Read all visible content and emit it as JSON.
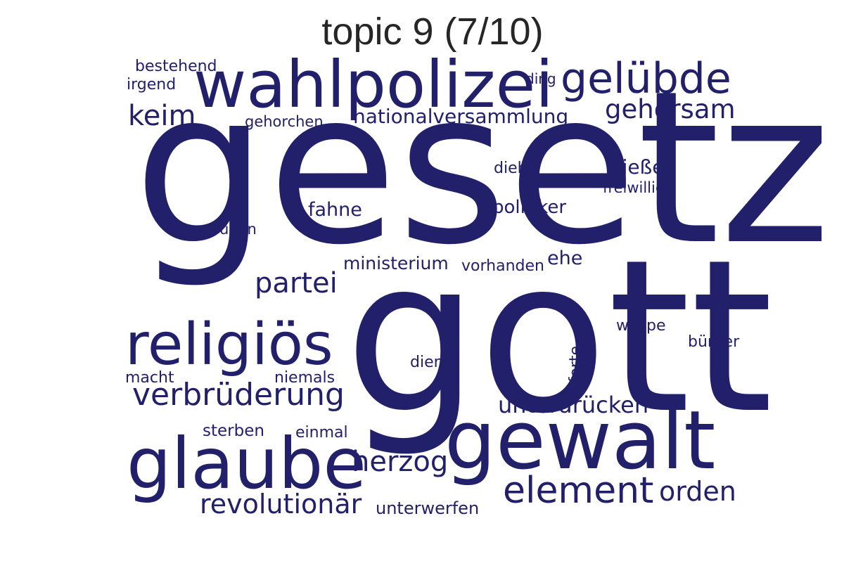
{
  "title": "topic 9 (7/10)",
  "word_color": "#22206b",
  "words": [
    {
      "text": "gesetz"
    },
    {
      "text": "gott"
    },
    {
      "text": "wahlpolizei"
    },
    {
      "text": "religiös"
    },
    {
      "text": "gewalt"
    },
    {
      "text": "glaube"
    },
    {
      "text": "gelübde"
    },
    {
      "text": "element"
    },
    {
      "text": "verbrüderung"
    },
    {
      "text": "herzog"
    },
    {
      "text": "revolutionär"
    },
    {
      "text": "partei"
    },
    {
      "text": "unterdrücken"
    },
    {
      "text": "keim"
    },
    {
      "text": "gehorsam"
    },
    {
      "text": "orden"
    },
    {
      "text": "nationalversammlung"
    },
    {
      "text": "fahne"
    },
    {
      "text": "politiker"
    },
    {
      "text": "fließen"
    },
    {
      "text": "ministerium"
    },
    {
      "text": "bestehend"
    },
    {
      "text": "irgend"
    },
    {
      "text": "gehorchen"
    },
    {
      "text": "ding"
    },
    {
      "text": "dieb"
    },
    {
      "text": "freiwillig"
    },
    {
      "text": "üben"
    },
    {
      "text": "vorhanden"
    },
    {
      "text": "ehe"
    },
    {
      "text": "pforte"
    },
    {
      "text": "wespe"
    },
    {
      "text": "bürger"
    },
    {
      "text": "dienst"
    },
    {
      "text": "macht"
    },
    {
      "text": "niemals"
    },
    {
      "text": "sterben"
    },
    {
      "text": "einmal"
    },
    {
      "text": "unterwerfen"
    }
  ]
}
